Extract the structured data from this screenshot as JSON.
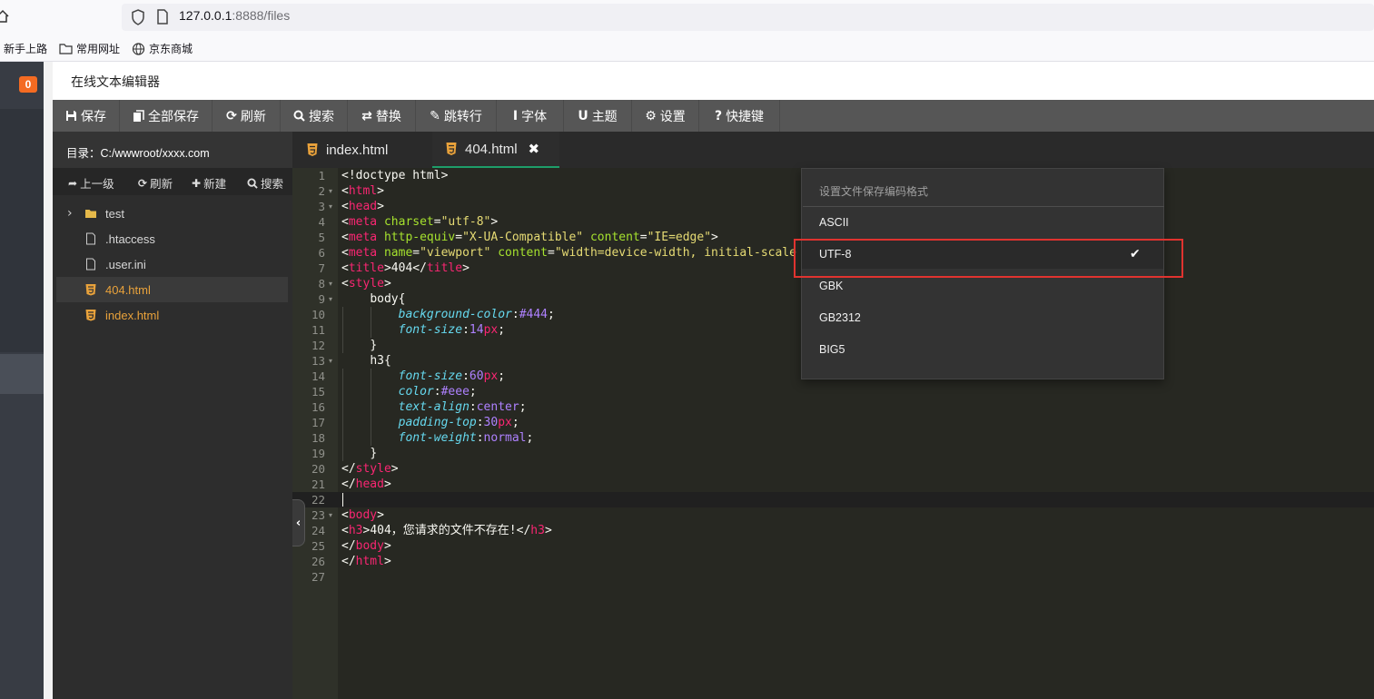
{
  "browser": {
    "url_host": "127.0.0.1",
    "url_rest": ":8888/files",
    "bookmarks": [
      "新手上路",
      "常用网址",
      "京东商城"
    ]
  },
  "left_strip": {
    "badge_count": "0"
  },
  "editor": {
    "title": "在线文本编辑器",
    "toolbar": [
      {
        "label": "保存",
        "icon": "save-icon"
      },
      {
        "label": "全部保存",
        "icon": "copy-icon"
      },
      {
        "label": "刷新",
        "icon": "refresh-icon"
      },
      {
        "label": "搜索",
        "icon": "search-icon"
      },
      {
        "label": "替换",
        "icon": "replace-icon"
      },
      {
        "label": "跳转行",
        "icon": "pin-icon"
      },
      {
        "label": "字体",
        "icon": "text-icon"
      },
      {
        "label": "主题",
        "icon": "magnet-icon"
      },
      {
        "label": "设置",
        "icon": "gear-icon"
      },
      {
        "label": "快捷键",
        "icon": "help-icon"
      }
    ],
    "sidebar": {
      "directory": "目录：C:/wwwroot/xxxx.com",
      "actions": [
        {
          "label": "上一级",
          "icon": "share-icon"
        },
        {
          "label": "刷新",
          "icon": "refresh-icon"
        },
        {
          "label": "新建",
          "icon": "plus-icon"
        },
        {
          "label": "搜索",
          "icon": "search-icon"
        }
      ],
      "tree": [
        {
          "name": "test",
          "type": "folder"
        },
        {
          "name": ".htaccess",
          "type": "file"
        },
        {
          "name": ".user.ini",
          "type": "file"
        },
        {
          "name": "404.html",
          "type": "html",
          "active": true
        },
        {
          "name": "index.html",
          "type": "html"
        }
      ]
    },
    "tabs": [
      {
        "label": "index.html",
        "active": false
      },
      {
        "label": "404.html",
        "active": true,
        "close": "✖"
      }
    ],
    "line_numbers": [
      "1",
      "2",
      "3",
      "4",
      "5",
      "6",
      "7",
      "8",
      "9",
      "10",
      "11",
      "12",
      "13",
      "14",
      "15",
      "16",
      "17",
      "18",
      "19",
      "20",
      "21",
      "22",
      "23",
      "24",
      "25",
      "26",
      "27"
    ],
    "encoding_menu": {
      "header": "设置文件保存编码格式",
      "options": [
        "ASCII",
        "UTF-8",
        "GBK",
        "GB2312",
        "BIG5"
      ],
      "selected": "UTF-8",
      "check": "✔"
    }
  },
  "code_lines": {
    "l1": "<!doctype html>",
    "l2_tag": "html",
    "l3_tag": "head",
    "l4_tag": "meta",
    "l4_attr": "charset",
    "l4_val": "\"utf-8\"",
    "l5_tag": "meta",
    "l5_attr1": "http-equiv",
    "l5_val1": "\"X-UA-Compatible\"",
    "l5_attr2": "content",
    "l5_val2": "\"IE=edge\"",
    "l6_tag": "meta",
    "l6_attr1": "name",
    "l6_val1": "\"viewport\"",
    "l6_attr2": "content",
    "l6_val2": "\"width=device-width, initial-scale",
    "l7_tag": "title",
    "l7_text": "404",
    "l8_tag": "style",
    "l9_sel": "body{",
    "l10_prop": "background-color",
    "l10_val": "#444",
    "l11_prop": "font-size",
    "l11_num": "14",
    "l11_unit": "px",
    "l12": "}",
    "l13_sel": "h3{",
    "l14_prop": "font-size",
    "l14_num": "60",
    "l14_unit": "px",
    "l15_prop": "color",
    "l15_val": "#eee",
    "l16_prop": "text-align",
    "l16_val": "center",
    "l17_prop": "padding-top",
    "l17_num": "30",
    "l17_unit": "px",
    "l18_prop": "font-weight",
    "l18_val": "normal",
    "l19": "}",
    "l20_tag": "style",
    "l21_tag": "head",
    "l23_tag": "body",
    "l24_tag": "h3",
    "l24_text": "404，您请求的文件不存在!",
    "l25_tag": "body",
    "l26_tag": "html"
  },
  "colors": {
    "accent_orange": "#f46b22",
    "tab_underline": "#1e9e6a",
    "highlight_red": "#e0332f"
  }
}
